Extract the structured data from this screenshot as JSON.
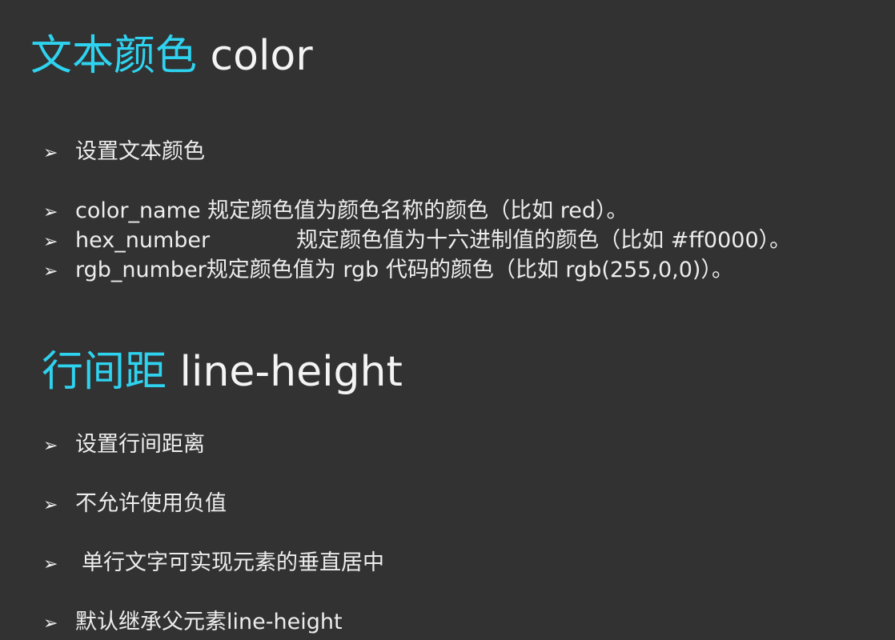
{
  "section_color": {
    "title_cn": "文本颜色",
    "title_en": "color",
    "items": [
      {
        "text": "设置文本颜色"
      },
      {
        "text": "color_name 规定颜色值为颜色名称的颜色（比如 red）。"
      },
      {
        "label": "hex_number",
        "text": "规定颜色值为十六进制值的颜色（比如 #ff0000）。"
      },
      {
        "text": "rgb_number规定颜色值为 rgb 代码的颜色（比如 rgb(255,0,0)）。"
      }
    ]
  },
  "section_line_height": {
    "title_cn": "行间距",
    "title_en": "line-height",
    "items": [
      {
        "text": "设置行间距离"
      },
      {
        "text": "不允许使用负值"
      },
      {
        "text": "单行文字可实现元素的垂直居中"
      },
      {
        "text": "默认继承父元素line-height"
      }
    ]
  },
  "bullet_symbol": "➢",
  "colors": {
    "background": "#323232",
    "heading_accent": "#2ed3f0",
    "text": "#f2f2f2"
  }
}
